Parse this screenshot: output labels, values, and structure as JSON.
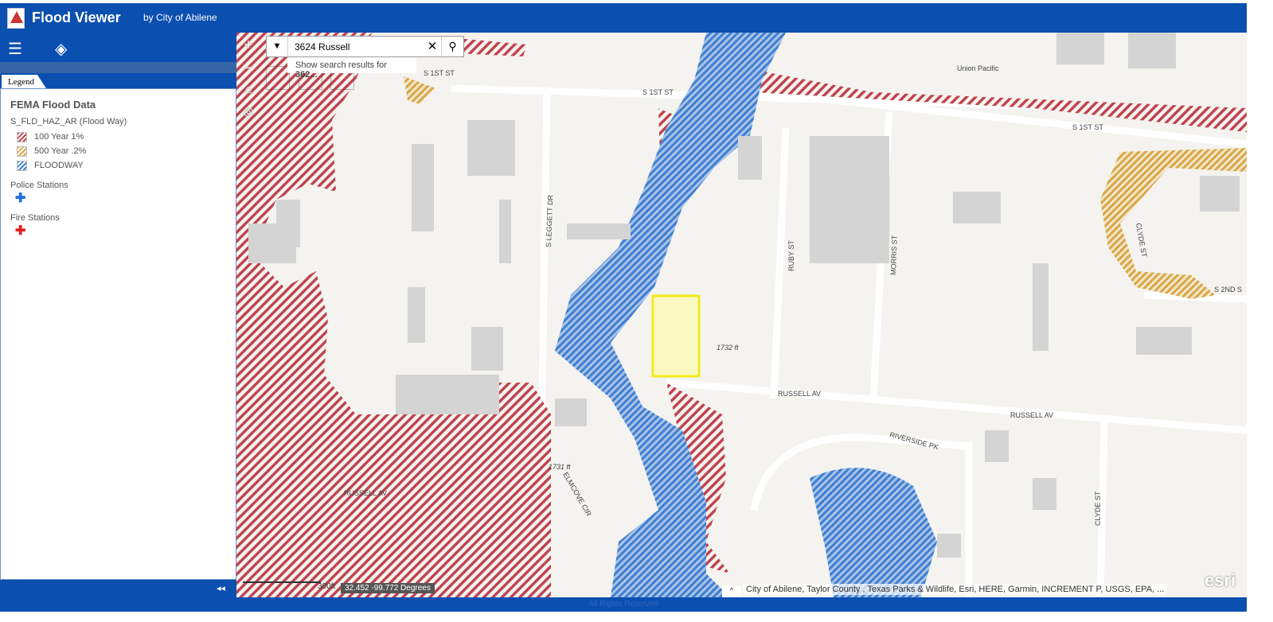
{
  "header": {
    "title": "Flood Viewer",
    "subtitle": "by City of Abilene"
  },
  "toolbar": {
    "icons": [
      "legend-list-icon",
      "layers-icon"
    ]
  },
  "legend": {
    "tab": "Legend",
    "group": "FEMA Flood Data",
    "layer": "S_FLD_HAZ_AR (Flood Way)",
    "items": [
      {
        "label": "100 Year 1%",
        "color": "#c0444f"
      },
      {
        "label": "500 Year .2%",
        "color": "#d9a64a"
      },
      {
        "label": "FLOODWAY",
        "color": "#3f7fd0"
      }
    ],
    "police": "Police Stations",
    "police_color": "#1f6fe0",
    "fire": "Fire Stations",
    "fire_color": "#e02020"
  },
  "search": {
    "value": "3624 Russell",
    "suggestion_prefix": "Show search results for ",
    "suggestion_term": "362..."
  },
  "map": {
    "streets": [
      "S 1ST ST",
      "S 1ST ST",
      "S 1ST ST",
      "Union Pacific",
      "S LEGGETT DR",
      "RUBY ST",
      "MORRIS ST",
      "RUSSELL AV",
      "RUSSELL AV",
      "RUSSELL AV",
      "RIVERSIDE PK",
      "CLYDE ST",
      "CLYDE ST",
      "S 2ND S",
      "ELMCOVE CIR"
    ],
    "elevations": [
      "1732 ft",
      "1731 ft"
    ],
    "scale": "300ft",
    "coords": "32.452 -99.772 Degrees",
    "attribution": "City of Abilene, Taylor County , Texas Parks & Wildlife, Esri, HERE, Garmin, INCREMENT P, USGS, EPA, ...",
    "esri": "esri"
  },
  "footer": "All Rights Reserved"
}
